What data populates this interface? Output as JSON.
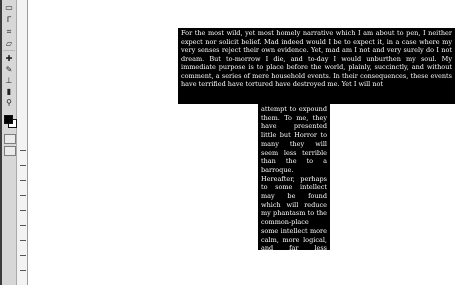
{
  "tools": [
    {
      "name": "marquee-tool-icon",
      "glyph": "▭"
    },
    {
      "name": "lasso-tool-icon",
      "glyph": "ᒥ"
    },
    {
      "name": "crop-tool-icon",
      "glyph": "⌗"
    },
    {
      "name": "slice-tool-icon",
      "glyph": "▱"
    },
    {
      "name": "healing-brush-icon",
      "glyph": "✚"
    },
    {
      "name": "brush-tool-icon",
      "glyph": "✎"
    },
    {
      "name": "clone-stamp-icon",
      "glyph": "⊥"
    },
    {
      "name": "eraser-tool-icon",
      "glyph": "▮"
    },
    {
      "name": "gradient-tool-icon",
      "glyph": "▥"
    },
    {
      "name": "dodge-tool-icon",
      "glyph": "●"
    },
    {
      "name": "type-tool-icon",
      "glyph": "T"
    },
    {
      "name": "pen-tool-icon",
      "glyph": "✒"
    },
    {
      "name": "hand-tool-icon",
      "glyph": "✋"
    },
    {
      "name": "zoom-tool-icon",
      "glyph": "⚲"
    }
  ],
  "document": {
    "text_top": "For the most wild, yet most homely narrative which I am about to pen, I neither expect nor solicit belief. Mad indeed would I be to expect it, in a case where my very senses reject their own evidence. Yet, mad am I not and very surely do I not dream. But to-morrow I die, and to-day I would unburthen my soul. My immediate purpose is to place before the world, plainly, succinctly, and without comment, a series of mere household events. In their consequences, these events have terrified have tortured have destroyed me. Yet I will not",
    "text_stem": "attempt to expound them. To me, they have presented little but Horror to many they will seem less terrible than the to a barroque. Hereafter, perhaps to some intellect may be found which will reduce my phantasm to the common-place some intellect more calm, more logical, and far less excitable than my own, which will perceive, into me the in t circumstances I detailed with gawe, nothing more than an ordinary a succession of very natural causes and effects. From my infancy I was noted."
  },
  "colors": {
    "toolbar_bg": "#d7d7d7",
    "text_block_bg": "#000000",
    "text_color": "#ffffff",
    "canvas_bg": "#ffffff"
  }
}
